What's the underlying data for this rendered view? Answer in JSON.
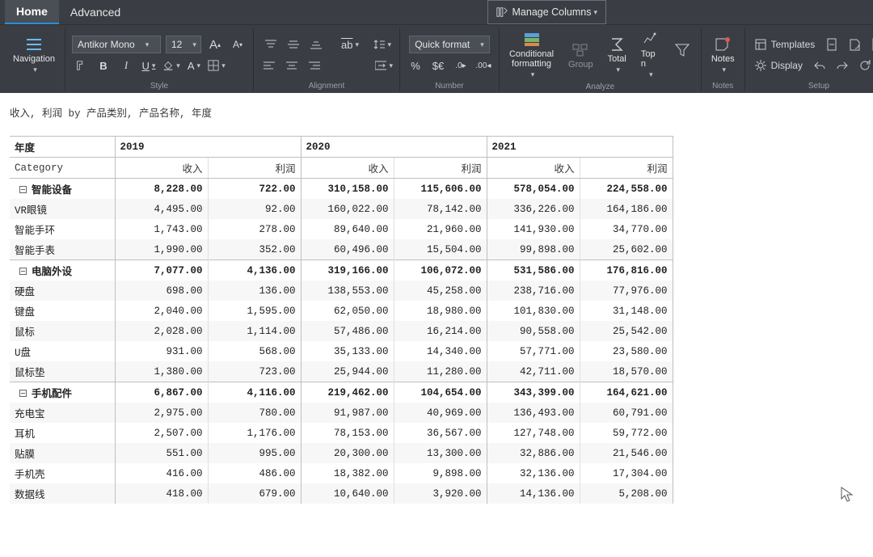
{
  "tabs": {
    "home": "Home",
    "advanced": "Advanced"
  },
  "manageColumns": "Manage Columns",
  "ribbon": {
    "navigation": "Navigation",
    "font": {
      "name": "Antikor Mono",
      "size": "12"
    },
    "quickFormat": "Quick format",
    "conditionalFormatting": "Conditional\nformatting",
    "group": "Group",
    "total": "Total",
    "topn": "Top n",
    "notes": "Notes",
    "templates": "Templates",
    "display": "Display",
    "groupLabels": {
      "style": "Style",
      "alignment": "Alignment",
      "number": "Number",
      "analyze": "Analyze",
      "notes": "Notes",
      "setup": "Setup"
    }
  },
  "report": {
    "title": "收入, 利润 by 产品类别, 产品名称, 年度",
    "cornerYear": "年度",
    "cornerCategory": "Category",
    "years": [
      "2019",
      "2020",
      "2021"
    ],
    "measures": [
      "收入",
      "利润"
    ],
    "groups": [
      {
        "name": "智能设备",
        "totals": [
          "8,228.00",
          "722.00",
          "310,158.00",
          "115,606.00",
          "578,054.00",
          "224,558.00"
        ],
        "rows": [
          {
            "name": "VR眼镜",
            "vals": [
              "4,495.00",
              "92.00",
              "160,022.00",
              "78,142.00",
              "336,226.00",
              "164,186.00"
            ]
          },
          {
            "name": "智能手环",
            "vals": [
              "1,743.00",
              "278.00",
              "89,640.00",
              "21,960.00",
              "141,930.00",
              "34,770.00"
            ]
          },
          {
            "name": "智能手表",
            "vals": [
              "1,990.00",
              "352.00",
              "60,496.00",
              "15,504.00",
              "99,898.00",
              "25,602.00"
            ]
          }
        ]
      },
      {
        "name": "电脑外设",
        "totals": [
          "7,077.00",
          "4,136.00",
          "319,166.00",
          "106,072.00",
          "531,586.00",
          "176,816.00"
        ],
        "rows": [
          {
            "name": "硬盘",
            "vals": [
              "698.00",
              "136.00",
              "138,553.00",
              "45,258.00",
              "238,716.00",
              "77,976.00"
            ]
          },
          {
            "name": "键盘",
            "vals": [
              "2,040.00",
              "1,595.00",
              "62,050.00",
              "18,980.00",
              "101,830.00",
              "31,148.00"
            ]
          },
          {
            "name": "鼠标",
            "vals": [
              "2,028.00",
              "1,114.00",
              "57,486.00",
              "16,214.00",
              "90,558.00",
              "25,542.00"
            ]
          },
          {
            "name": "U盘",
            "vals": [
              "931.00",
              "568.00",
              "35,133.00",
              "14,340.00",
              "57,771.00",
              "23,580.00"
            ]
          },
          {
            "name": "鼠标垫",
            "vals": [
              "1,380.00",
              "723.00",
              "25,944.00",
              "11,280.00",
              "42,711.00",
              "18,570.00"
            ]
          }
        ]
      },
      {
        "name": "手机配件",
        "totals": [
          "6,867.00",
          "4,116.00",
          "219,462.00",
          "104,654.00",
          "343,399.00",
          "164,621.00"
        ],
        "rows": [
          {
            "name": "充电宝",
            "vals": [
              "2,975.00",
              "780.00",
              "91,987.00",
              "40,969.00",
              "136,493.00",
              "60,791.00"
            ]
          },
          {
            "name": "耳机",
            "vals": [
              "2,507.00",
              "1,176.00",
              "78,153.00",
              "36,567.00",
              "127,748.00",
              "59,772.00"
            ]
          },
          {
            "name": "贴膜",
            "vals": [
              "551.00",
              "995.00",
              "20,300.00",
              "13,300.00",
              "32,886.00",
              "21,546.00"
            ]
          },
          {
            "name": "手机壳",
            "vals": [
              "416.00",
              "486.00",
              "18,382.00",
              "9,898.00",
              "32,136.00",
              "17,304.00"
            ]
          },
          {
            "name": "数据线",
            "vals": [
              "418.00",
              "679.00",
              "10,640.00",
              "3,920.00",
              "14,136.00",
              "5,208.00"
            ]
          }
        ]
      }
    ]
  }
}
